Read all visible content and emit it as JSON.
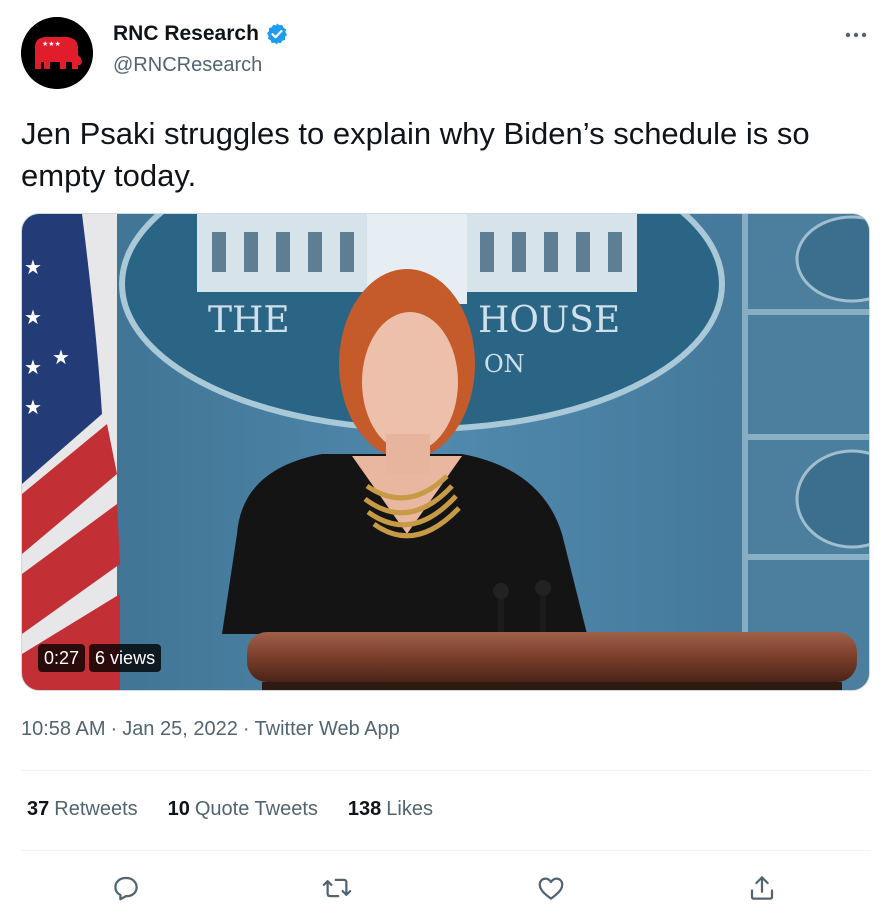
{
  "author": {
    "display_name": "RNC Research",
    "handle": "@RNCResearch",
    "verified": true
  },
  "tweet": {
    "text": "Jen Psaki struggles to explain why Biden’s schedule is so empty today."
  },
  "media": {
    "type": "video",
    "duration": "0:27",
    "views": "6 views",
    "backdrop_text": [
      "THE",
      "HOUSE",
      "ON"
    ]
  },
  "meta": {
    "time": "10:58 AM",
    "date": "Jan 25, 2022",
    "source": "Twitter Web App",
    "sep": "·"
  },
  "stats": {
    "retweets_count": "37",
    "retweets_label": "Retweets",
    "quotes_count": "10",
    "quotes_label": "Quote Tweets",
    "likes_count": "138",
    "likes_label": "Likes"
  },
  "actions": [
    "reply-icon",
    "retweet-icon",
    "like-icon",
    "share-icon"
  ],
  "colors": {
    "text": "#0f1419",
    "secondary": "#536471",
    "verified": "#1d9bf0",
    "divider": "#eff3f4"
  }
}
